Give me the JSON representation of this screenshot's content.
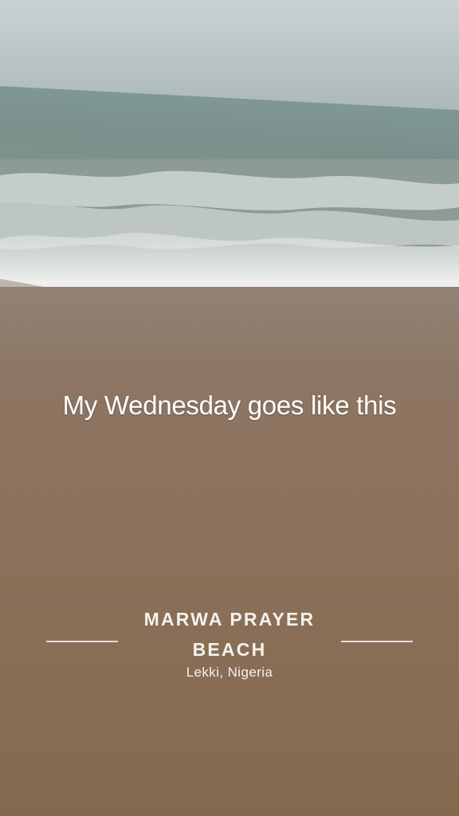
{
  "caption": "My Wednesday goes like this",
  "location": {
    "title": "MARWA PRAYER\nBEACH",
    "title_line1": "MARWA PRAYER",
    "title_line2": "BEACH",
    "subtitle": "Lekki, Nigeria"
  },
  "colors": {
    "sky": "#c0cacc",
    "sea": "#7f9795",
    "foam": "#f2f4f2",
    "sand": "#8b7059",
    "text": "#ffffff"
  }
}
